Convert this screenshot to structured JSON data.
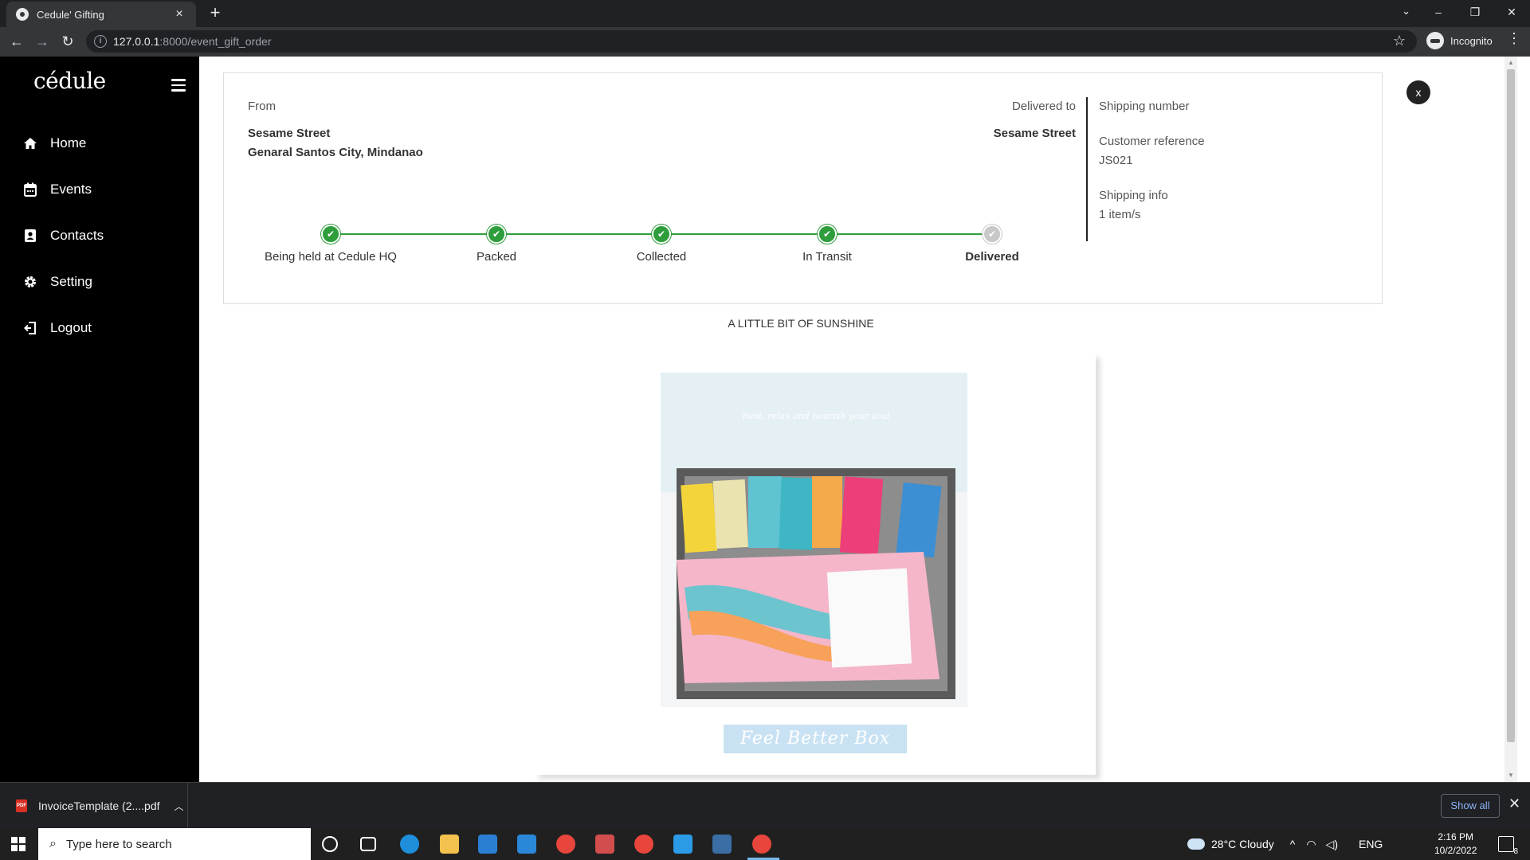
{
  "browser": {
    "tab_title": "Cedule' Gifting",
    "url_host": "127.0.0.1",
    "url_path": ":8000/event_gift_order",
    "profile_label": "Incognito"
  },
  "sidebar": {
    "logo": "cédule",
    "items": [
      {
        "label": "Home",
        "icon": "home-icon"
      },
      {
        "label": "Events",
        "icon": "calendar-icon"
      },
      {
        "label": "Contacts",
        "icon": "contacts-icon"
      },
      {
        "label": "Setting",
        "icon": "gear-icon"
      },
      {
        "label": "Logout",
        "icon": "logout-icon"
      }
    ]
  },
  "order": {
    "from_label": "From",
    "from_line1": "Sesame Street",
    "from_line2": "Genaral Santos City, Mindanao",
    "delivered_to_label": "Delivered to",
    "delivered_to_addr": "Sesame Street",
    "shipping_number_label": "Shipping number",
    "customer_reference_label": "Customer reference",
    "customer_reference_value": "JS021",
    "shipping_info_label": "Shipping info",
    "shipping_info_value": "1 item/s",
    "steps": [
      {
        "label": "Being held at Cedule HQ",
        "done": true
      },
      {
        "label": "Packed",
        "done": true
      },
      {
        "label": "Collected",
        "done": true
      },
      {
        "label": "In Transit",
        "done": true
      },
      {
        "label": "Delivered",
        "done": false
      }
    ],
    "close_label": "x"
  },
  "gift": {
    "name": "A LITTLE BIT OF SUNSHINE",
    "box_title": "Feel Better Box",
    "lid_text": "Rest, relax and nourish your soul"
  },
  "downloads": {
    "file_name": "InvoiceTemplate (2....pdf",
    "show_all": "Show all"
  },
  "taskbar": {
    "search_placeholder": "Type here to search",
    "weather": "28°C  Cloudy",
    "language": "ENG",
    "time": "2:16 PM",
    "date": "10/2/2022",
    "notification_count": "8"
  },
  "colors": {
    "sidebar_bg": "#000000",
    "step_done": "#2e9d3b",
    "step_pending": "#c8c8c8",
    "box_title_bg": "#c9e2f3"
  }
}
